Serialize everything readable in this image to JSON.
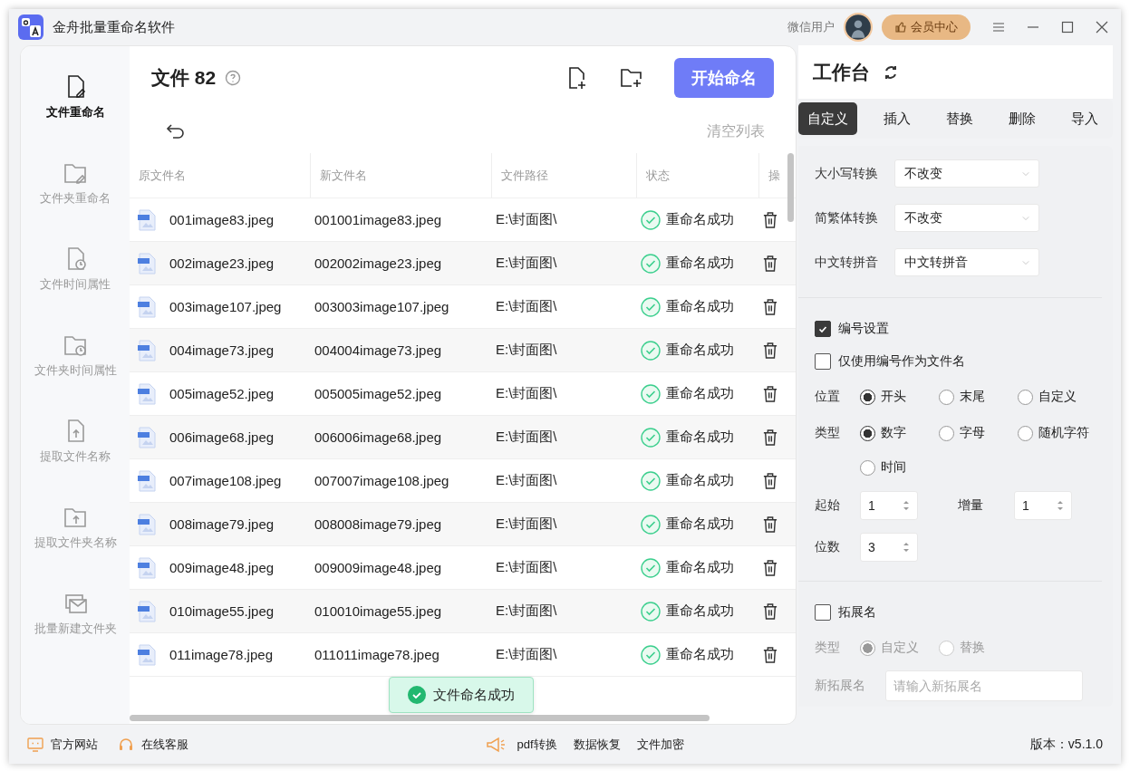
{
  "window": {
    "title": "金舟批量重命名软件",
    "user": "微信用户",
    "vip_button": "会员中心"
  },
  "sidebar": {
    "items": [
      {
        "label": "文件重命名",
        "selected": true
      },
      {
        "label": "文件夹重命名",
        "selected": false
      },
      {
        "label": "文件时间属性",
        "selected": false
      },
      {
        "label": "文件夹时间属性",
        "selected": false
      },
      {
        "label": "提取文件名称",
        "selected": false
      },
      {
        "label": "提取文件夹名称",
        "selected": false
      },
      {
        "label": "批量新建文件夹",
        "selected": false
      }
    ]
  },
  "files": {
    "title": "文件",
    "count": "82",
    "start_button": "开始命名",
    "clear_button": "清空列表",
    "table": {
      "columns": [
        "原文件名",
        "新文件名",
        "文件路径",
        "状态",
        "操"
      ],
      "rows": [
        {
          "original": "001image83.jpeg",
          "new_name": "001001image83.jpeg",
          "path": "E:\\封面图\\",
          "status": "重命名成功"
        },
        {
          "original": "002image23.jpeg",
          "new_name": "002002image23.jpeg",
          "path": "E:\\封面图\\",
          "status": "重命名成功"
        },
        {
          "original": "003image107.jpeg",
          "new_name": "003003image107.jpeg",
          "path": "E:\\封面图\\",
          "status": "重命名成功"
        },
        {
          "original": "004image73.jpeg",
          "new_name": "004004image73.jpeg",
          "path": "E:\\封面图\\",
          "status": "重命名成功"
        },
        {
          "original": "005image52.jpeg",
          "new_name": "005005image52.jpeg",
          "path": "E:\\封面图\\",
          "status": "重命名成功"
        },
        {
          "original": "006image68.jpeg",
          "new_name": "006006image68.jpeg",
          "path": "E:\\封面图\\",
          "status": "重命名成功"
        },
        {
          "original": "007image108.jpeg",
          "new_name": "007007image108.jpeg",
          "path": "E:\\封面图\\",
          "status": "重命名成功"
        },
        {
          "original": "008image79.jpeg",
          "new_name": "008008image79.jpeg",
          "path": "E:\\封面图\\",
          "status": "重命名成功"
        },
        {
          "original": "009image48.jpeg",
          "new_name": "009009image48.jpeg",
          "path": "E:\\封面图\\",
          "status": "重命名成功"
        },
        {
          "original": "010image55.jpeg",
          "new_name": "010010image55.jpeg",
          "path": "E:\\封面图\\",
          "status": "重命名成功"
        },
        {
          "original": "011image78.jpeg",
          "new_name": "011011image78.jpeg",
          "path": "E:\\封面图\\",
          "status": "重命名成功"
        }
      ]
    },
    "toast": "文件命名成功"
  },
  "workbench": {
    "title": "工作台",
    "tabs": [
      {
        "label": "自定义",
        "selected": true
      },
      {
        "label": "插入",
        "selected": false
      },
      {
        "label": "替换",
        "selected": false
      },
      {
        "label": "删除",
        "selected": false
      },
      {
        "label": "导入",
        "selected": false
      }
    ],
    "selects": [
      {
        "label": "大小写转换",
        "value": "不改变"
      },
      {
        "label": "简繁体转换",
        "value": "不改变"
      },
      {
        "label": "中文转拼音",
        "value": "中文转拼音"
      }
    ],
    "numbering": {
      "label": "编号设置",
      "checked": true,
      "only_number": {
        "label": "仅使用编号作为文件名",
        "checked": false
      },
      "position": {
        "label": "位置",
        "options": [
          {
            "label": "开头",
            "selected": true
          },
          {
            "label": "末尾",
            "selected": false
          },
          {
            "label": "自定义",
            "selected": false
          }
        ]
      },
      "type": {
        "label": "类型",
        "options": [
          {
            "label": "数字",
            "selected": true
          },
          {
            "label": "字母",
            "selected": false
          },
          {
            "label": "随机字符",
            "selected": false
          },
          {
            "label": "时间",
            "selected": false
          }
        ]
      },
      "start": {
        "label": "起始",
        "value": "1"
      },
      "step": {
        "label": "增量",
        "value": "1"
      },
      "digits": {
        "label": "位数",
        "value": "3"
      }
    },
    "extension": {
      "label": "拓展名",
      "checked": false,
      "disabled": true,
      "type": {
        "label": "类型",
        "options": [
          {
            "label": "自定义",
            "selected": true
          },
          {
            "label": "替换",
            "selected": false
          }
        ]
      },
      "new_ext": {
        "label": "新拓展名",
        "placeholder": "请输入新拓展名"
      }
    }
  },
  "footer": {
    "links": [
      "官方网站",
      "在线客服"
    ],
    "tools": [
      "pdf转换",
      "数据恢复",
      "文件加密"
    ],
    "version": "版本：v5.1.0"
  }
}
